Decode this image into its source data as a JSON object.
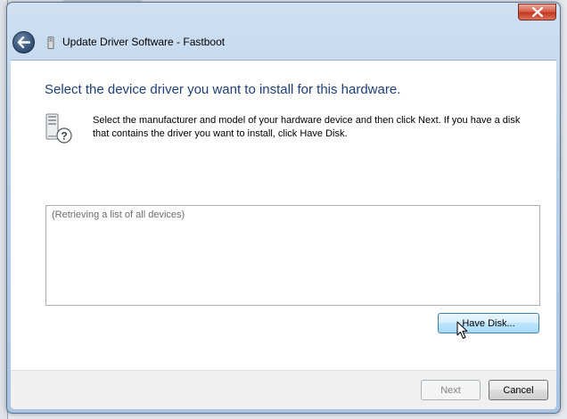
{
  "dialog": {
    "title": "Update Driver Software - Fastboot",
    "heading": "Select the device driver you want to install for this hardware.",
    "instructions": "Select the manufacturer and model of your hardware device and then click Next. If you have a disk that contains the driver you want to install, click Have Disk.",
    "device_list": {
      "placeholder": "(Retrieving a list of all devices)"
    },
    "buttons": {
      "have_disk": "Have Disk...",
      "next": "Next",
      "cancel": "Cancel"
    }
  },
  "icons": {
    "back": "back-arrow-icon",
    "close": "close-icon",
    "title": "device-icon",
    "hardware": "hardware-help-icon",
    "cursor": "mouse-pointer-icon"
  },
  "colors": {
    "heading": "#1e3f7a",
    "close_button": "#c3381f",
    "focus_button_border": "#3c7fb1",
    "disabled_text": "#838383"
  }
}
